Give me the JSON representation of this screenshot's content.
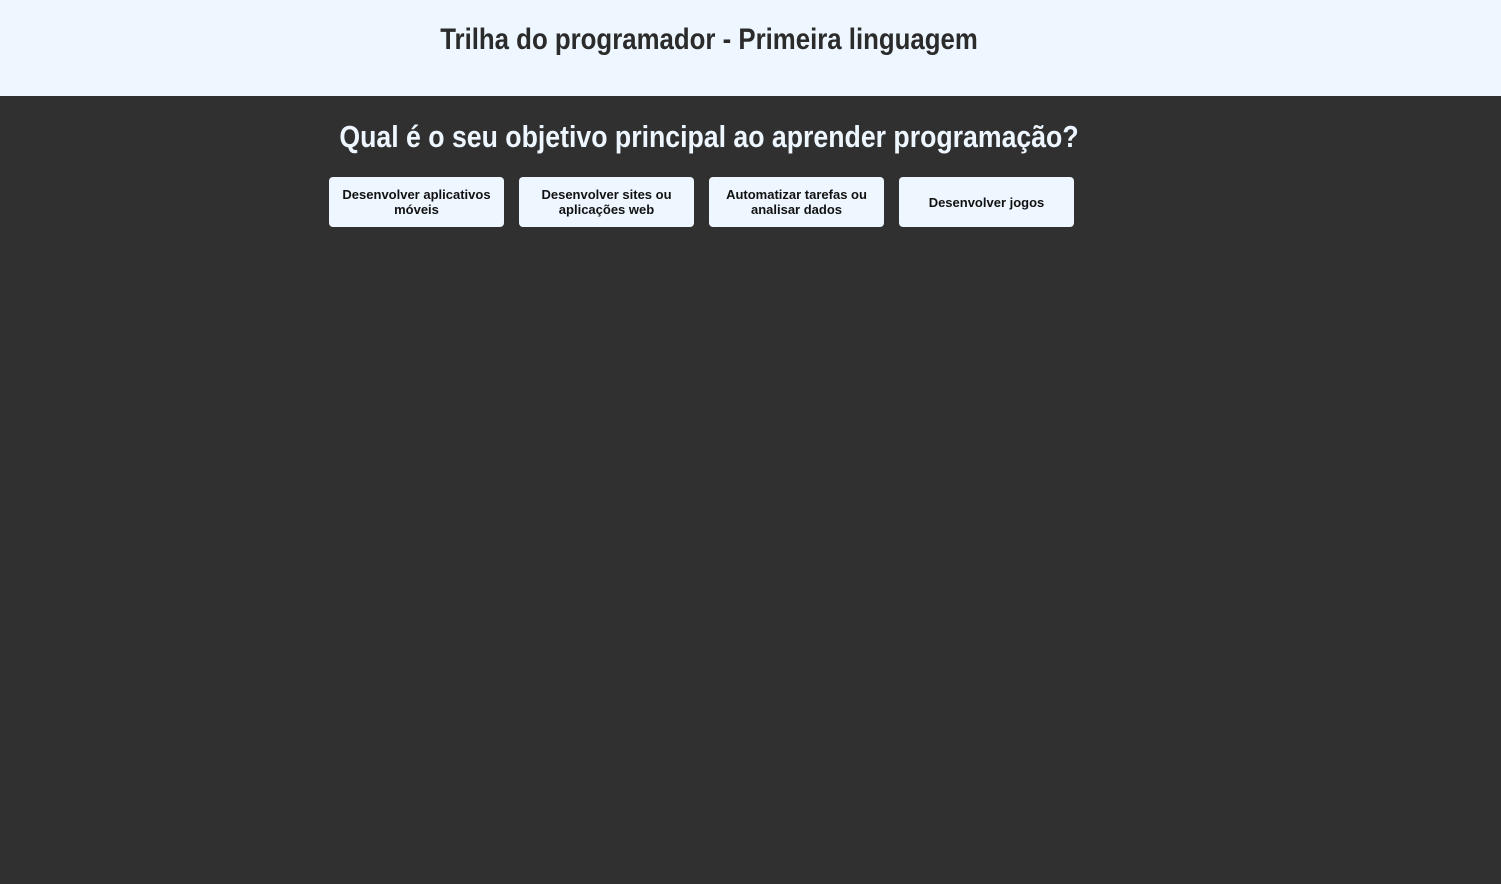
{
  "header": {
    "title": "Trilha do programador - Primeira linguagem"
  },
  "quiz": {
    "question": "Qual é o seu objetivo principal ao aprender programação?",
    "options": [
      {
        "label": "Desenvolver aplicativos móveis"
      },
      {
        "label": "Desenvolver sites ou aplicações web"
      },
      {
        "label": "Automatizar tarefas ou analisar dados"
      },
      {
        "label": "Desenvolver jogos"
      }
    ]
  },
  "colors": {
    "header_background": "#eef7ff",
    "page_background": "#303030",
    "button_background": "#eef7ff",
    "title_text": "#2b2b2b",
    "question_text": "#eef7ff"
  }
}
